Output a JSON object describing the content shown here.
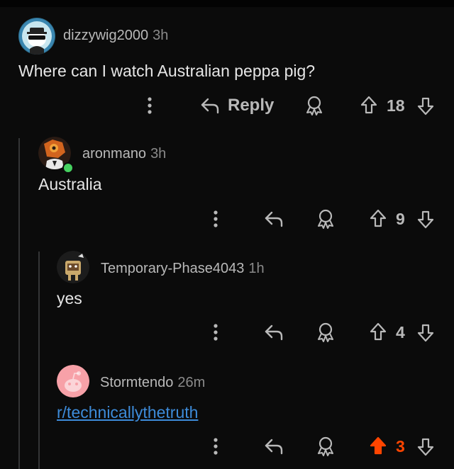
{
  "comments": [
    {
      "username": "dizzywig2000",
      "time": "3h",
      "text": "Where can I watch Australian peppa pig?",
      "reply_label": "Reply",
      "votes": "18",
      "upvoted": false
    },
    {
      "username": "aronmano",
      "time": "3h",
      "text": "Australia",
      "votes": "9",
      "upvoted": false,
      "online": true
    },
    {
      "username": "Temporary-Phase4043",
      "time": "1h",
      "text": "yes",
      "votes": "4",
      "upvoted": false
    },
    {
      "username": "Stormtendo",
      "time": "26m",
      "link": "r/technicallythetruth",
      "votes": "3",
      "upvoted": true
    }
  ],
  "colors": {
    "background": "#0b0b0b",
    "upvote_active": "#ff4500",
    "link": "#3d8bd9",
    "thread_line": "#343536"
  },
  "icons": [
    "more-options-icon",
    "reply-arrow-icon",
    "award-icon",
    "upvote-arrow-icon",
    "downvote-arrow-icon",
    "online-status-dot"
  ]
}
